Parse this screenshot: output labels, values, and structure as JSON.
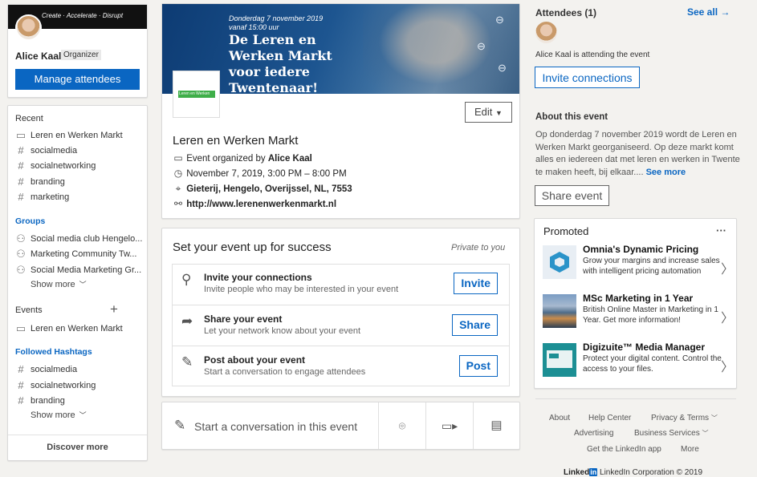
{
  "profile": {
    "banner_text": "Create · Accelerate · Disrupt",
    "name": "Alice Kaal",
    "role_badge": "Organizer",
    "manage_button": "Manage attendees"
  },
  "left_nav": {
    "recent_label": "Recent",
    "recent": [
      {
        "icon": "calendar-icon",
        "label": "Leren en Werken Markt"
      },
      {
        "icon": "hashtag-icon",
        "label": "socialmedia"
      },
      {
        "icon": "hashtag-icon",
        "label": "socialnetworking"
      },
      {
        "icon": "hashtag-icon",
        "label": "branding"
      },
      {
        "icon": "hashtag-icon",
        "label": "marketing"
      }
    ],
    "groups_label": "Groups",
    "groups": [
      {
        "icon": "group-icon",
        "label": "Social media club Hengelo..."
      },
      {
        "icon": "group-icon",
        "label": "Marketing Community Tw..."
      },
      {
        "icon": "group-icon",
        "label": "Social Media Marketing Gr..."
      }
    ],
    "show_more_1": "Show more",
    "events_label": "Events",
    "events_add": "+",
    "events": [
      {
        "icon": "calendar-icon",
        "label": "Leren en Werken Markt"
      }
    ],
    "hashtags_label": "Followed Hashtags",
    "hashtags": [
      {
        "icon": "hashtag-icon",
        "label": "socialmedia"
      },
      {
        "icon": "hashtag-icon",
        "label": "socialnetworking"
      },
      {
        "icon": "hashtag-icon",
        "label": "branding"
      }
    ],
    "show_more_2": "Show more",
    "discover": "Discover more"
  },
  "event": {
    "banner_date": "Donderdag 7 november 2019",
    "banner_time": "vanaf 15:00 uur",
    "banner_headline": [
      "De Leren en",
      "Werken Markt",
      "voor iedere",
      "Twentenaar!"
    ],
    "logo_text": "Leren en Werken",
    "edit_label": "Edit",
    "title": "Leren en Werken Markt",
    "organized_prefix": "Event organized by",
    "organizer": "Alice Kaal",
    "datetime": "November 7, 2019, 3:00 PM – 8:00 PM",
    "location": "Gieterij, Hengelo, Overijssel, NL, 7553",
    "url": "http://www.lerenenwerkenmarkt.nl"
  },
  "setup": {
    "title": "Set your event up for success",
    "privacy": "Private to you",
    "tasks": [
      {
        "icon": "add-person-icon",
        "title": "Invite your connections",
        "subtitle": "Invite people who may be interested in your event",
        "button": "Invite"
      },
      {
        "icon": "share-icon",
        "title": "Share your event",
        "subtitle": "Let your network know about your event",
        "button": "Share"
      },
      {
        "icon": "edit-icon",
        "title": "Post about your event",
        "subtitle": "Start a conversation to engage attendees",
        "button": "Post"
      }
    ]
  },
  "composer": {
    "placeholder": "Start a conversation in this event"
  },
  "attendees": {
    "title": "Attendees (1)",
    "see_all": "See all",
    "attending_text": "Alice Kaal is attending the event",
    "invite_button": "Invite connections"
  },
  "about": {
    "title": "About this event",
    "description": "Op donderdag 7 november 2019 wordt de Leren en Werken Markt georganiseerd. Op deze markt komt alles en iedereen dat met leren en werken in Twente te maken heeft, bij elkaar....",
    "see_more": "See more",
    "share_button": "Share event"
  },
  "promoted": {
    "title": "Promoted",
    "more": "···",
    "items": [
      {
        "title": "Omnia's Dynamic Pricing",
        "desc": "Grow your margins and increase sales with intelligent pricing automation"
      },
      {
        "title": "MSc Marketing in 1 Year",
        "desc": "British Online Master in Marketing in 1 Year. Get more information!"
      },
      {
        "title": "Digizuite™ Media Manager",
        "desc": "Protect your digital content. Control the access to your files."
      }
    ]
  },
  "footer": {
    "about": "About",
    "help": "Help Center",
    "privacy": "Privacy & Terms",
    "advertising": "Advertising",
    "business": "Business Services",
    "app": "Get the LinkedIn app",
    "more": "More",
    "brand": "Linked",
    "brand_in": "in",
    "copyright": "LinkedIn Corporation © 2019"
  },
  "colors": {
    "accent": "#0a66c2",
    "banner": "#1d4f86"
  }
}
